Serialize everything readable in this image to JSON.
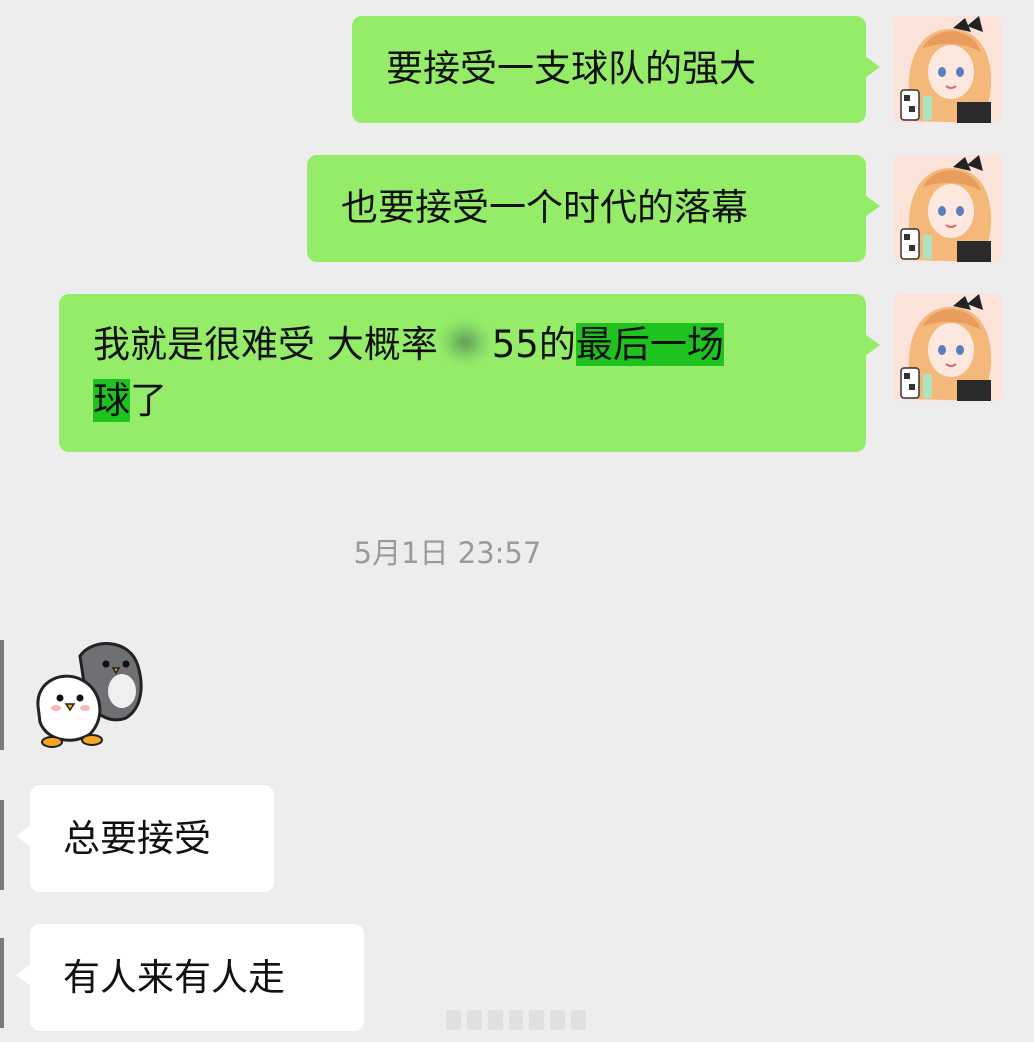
{
  "conversation": {
    "outgoing": [
      {
        "text": "要接受一支球队的强大"
      },
      {
        "text": "也要接受一个时代的落幕"
      },
      {
        "before": "我就是很难受 大概率",
        "after_blur": "55的",
        "highlight_1": "最后一场",
        "highlight_2": "球",
        "tail": "了"
      }
    ],
    "timestamp": "5月1日 23:57",
    "incoming": [
      {
        "text": "总要接受"
      },
      {
        "text": "有人来有人走"
      }
    ]
  },
  "colors": {
    "background": "#ededed",
    "outgoing_bubble": "#95ec69",
    "incoming_bubble": "#ffffff",
    "highlight": "#1fc31f",
    "timestamp": "#9a9a9a"
  }
}
